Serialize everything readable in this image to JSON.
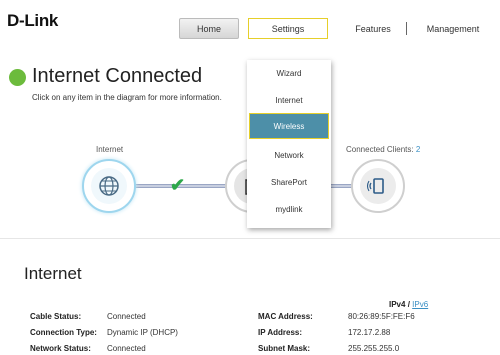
{
  "brand": {
    "logo": "D-Link"
  },
  "nav": {
    "home": "Home",
    "settings": "Settings",
    "features": "Features",
    "management": "Management"
  },
  "status": {
    "title": "Internet Connected",
    "subtitle": "Click on any item in the diagram for more information.",
    "color": "#6cbb3c"
  },
  "diagram": {
    "internet_label": "Internet",
    "clients_label": "Connected Clients:",
    "clients_count": "2"
  },
  "settings_menu": {
    "items": [
      "Wizard",
      "Internet",
      "Wireless",
      "Network",
      "SharePort",
      "mydlink"
    ],
    "active": "Wireless"
  },
  "internet_section": {
    "title": "Internet",
    "ipv4": "IPv4",
    "separator": "/",
    "ipv6": "IPv6",
    "left": [
      {
        "label": "Cable Status:",
        "value": "Connected"
      },
      {
        "label": "Connection Type:",
        "value": "Dynamic IP (DHCP)"
      },
      {
        "label": "Network Status:",
        "value": "Connected"
      }
    ],
    "right": [
      {
        "label": "MAC Address:",
        "value": "80:26:89:5F:FE:F6"
      },
      {
        "label": "IP Address:",
        "value": "172.17.2.88"
      },
      {
        "label": "Subnet Mask:",
        "value": "255.255.255.0"
      }
    ]
  },
  "colors": {
    "accent": "#4d8fa8",
    "highlight_border": "#e6cf2a",
    "link": "#3a8fc4",
    "check": "#2da84a"
  }
}
